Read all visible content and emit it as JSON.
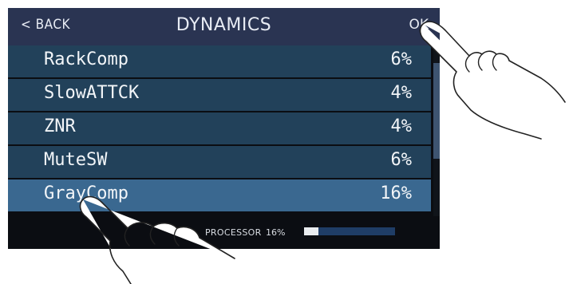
{
  "header": {
    "back_label": "< BACK",
    "title": "DYNAMICS",
    "ok_label": "OK"
  },
  "effects": [
    {
      "name": "RackComp",
      "percent": "6%"
    },
    {
      "name": "SlowATTCK",
      "percent": "4%"
    },
    {
      "name": "ZNR",
      "percent": "4%"
    },
    {
      "name": "MuteSW",
      "percent": "6%"
    },
    {
      "name": "GrayComp",
      "percent": "16%",
      "selected": true
    }
  ],
  "footer": {
    "processor_label": "PROCESSOR",
    "processor_value": "16%",
    "processor_level": 0.16
  },
  "colors": {
    "header_bg": "#2a3452",
    "row_bg": "#22415a",
    "row_selected_bg": "#3a6890",
    "screen_bg": "#0b0d12",
    "meter_bg": "#1f3d66"
  }
}
